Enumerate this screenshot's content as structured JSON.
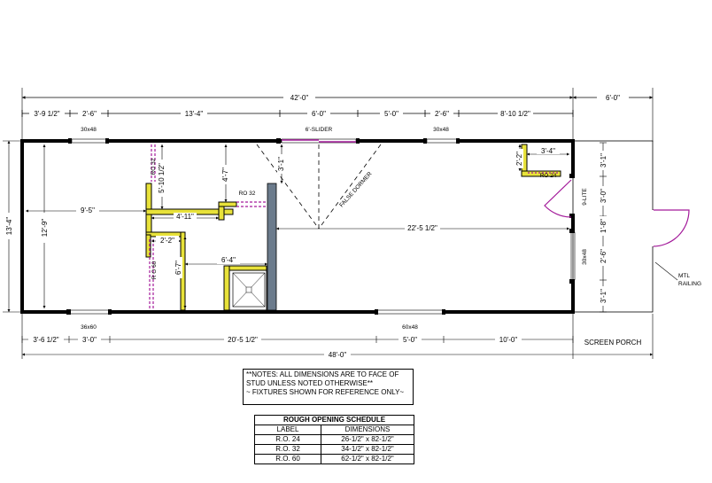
{
  "dims": {
    "top_overall": "42'-0\"",
    "top_porch": "6'-0\"",
    "top_segments": [
      "3'-9 1/2\"",
      "2'-6\"",
      "13'-4\"",
      "6'-0\"",
      "5'-0\"",
      "2'-6\"",
      "8'-10 1/2\""
    ],
    "bottom_segments": [
      "3'-6 1/2\"",
      "3'-0\"",
      "20'-5 1/2\"",
      "5'-0\"",
      "10'-0\""
    ],
    "bottom_overall": "48'-0\"",
    "left_outer": "13'-4\"",
    "left_inner": "12'-9\"",
    "right_segments": [
      "3'-1\"",
      "3'-0\"",
      "1'-8\"",
      "2'-6\"",
      "3'-1\""
    ],
    "interior": {
      "d_9_5": "9'-5\"",
      "d_5_10": "5'-10 1/2\"",
      "d_4_7": "4'-7\"",
      "d_4_11": "4'-11\"",
      "d_2_2a": "2'-2\"",
      "d_6_7": "6'-7\"",
      "d_6_4": "6'-4\"",
      "d_3_1": "3'-1\"",
      "d_22_5": "22'-5 1/2\"",
      "d_2_2b": "2'-2\"",
      "d_3_4": "3'-4\""
    }
  },
  "labels": {
    "window_30x48_a": "30x48",
    "window_30x48_b": "30x48",
    "slider": "6'-SLIDER",
    "window_36x60": "36x60",
    "window_60x48": "60x48",
    "window_30x48_side": "30x48",
    "ro32_a": "RO 32",
    "ro32_b": "RO 32",
    "ro60": "R O 60",
    "ro24": "RO 24",
    "nine_lite": "9-LITE",
    "false_dormer": "FALSE DORMER",
    "mtl_railing_1": "MTL",
    "mtl_railing_2": "RAILING",
    "screen_porch": "SCREEN PORCH"
  },
  "notes": {
    "line1": "**NOTES:  ALL DIMENSIONS ARE TO FACE OF",
    "line2": "STUD UNLESS NOTED OTHERWISE**",
    "line3": "~ FIXTURES SHOWN FOR REFERENCE ONLY~"
  },
  "schedule": {
    "title": "ROUGH OPENING SCHEDULE",
    "headers": [
      "LABEL",
      "DIMENSIONS"
    ],
    "rows": [
      [
        "R.O. 24",
        "26-1/2\" x 82-1/2\""
      ],
      [
        "R.O. 32",
        "34-1/2\" x 82-1/2\""
      ],
      [
        "R.O. 60",
        "62-1/2\" x 82-1/2\""
      ]
    ]
  },
  "colors": {
    "wall": "#000000",
    "interior_wall_fill": "#e8e23a",
    "door": "#a31a9a",
    "post": "#6b7b8c"
  }
}
